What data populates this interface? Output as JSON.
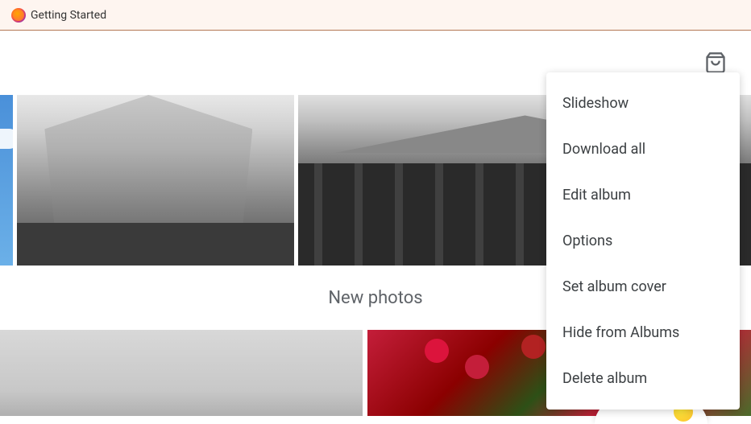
{
  "bookmarks": {
    "items": [
      {
        "label": "Getting Started"
      }
    ]
  },
  "toolbar": {
    "shopping_bag": "shopping-bag-icon"
  },
  "sections": {
    "new_photos_title": "New photos"
  },
  "dropdown": {
    "items": [
      {
        "label": "Slideshow"
      },
      {
        "label": "Download all"
      },
      {
        "label": "Edit album"
      },
      {
        "label": "Options"
      },
      {
        "label": "Set album cover"
      },
      {
        "label": "Hide from Albums"
      },
      {
        "label": "Delete album"
      }
    ]
  }
}
